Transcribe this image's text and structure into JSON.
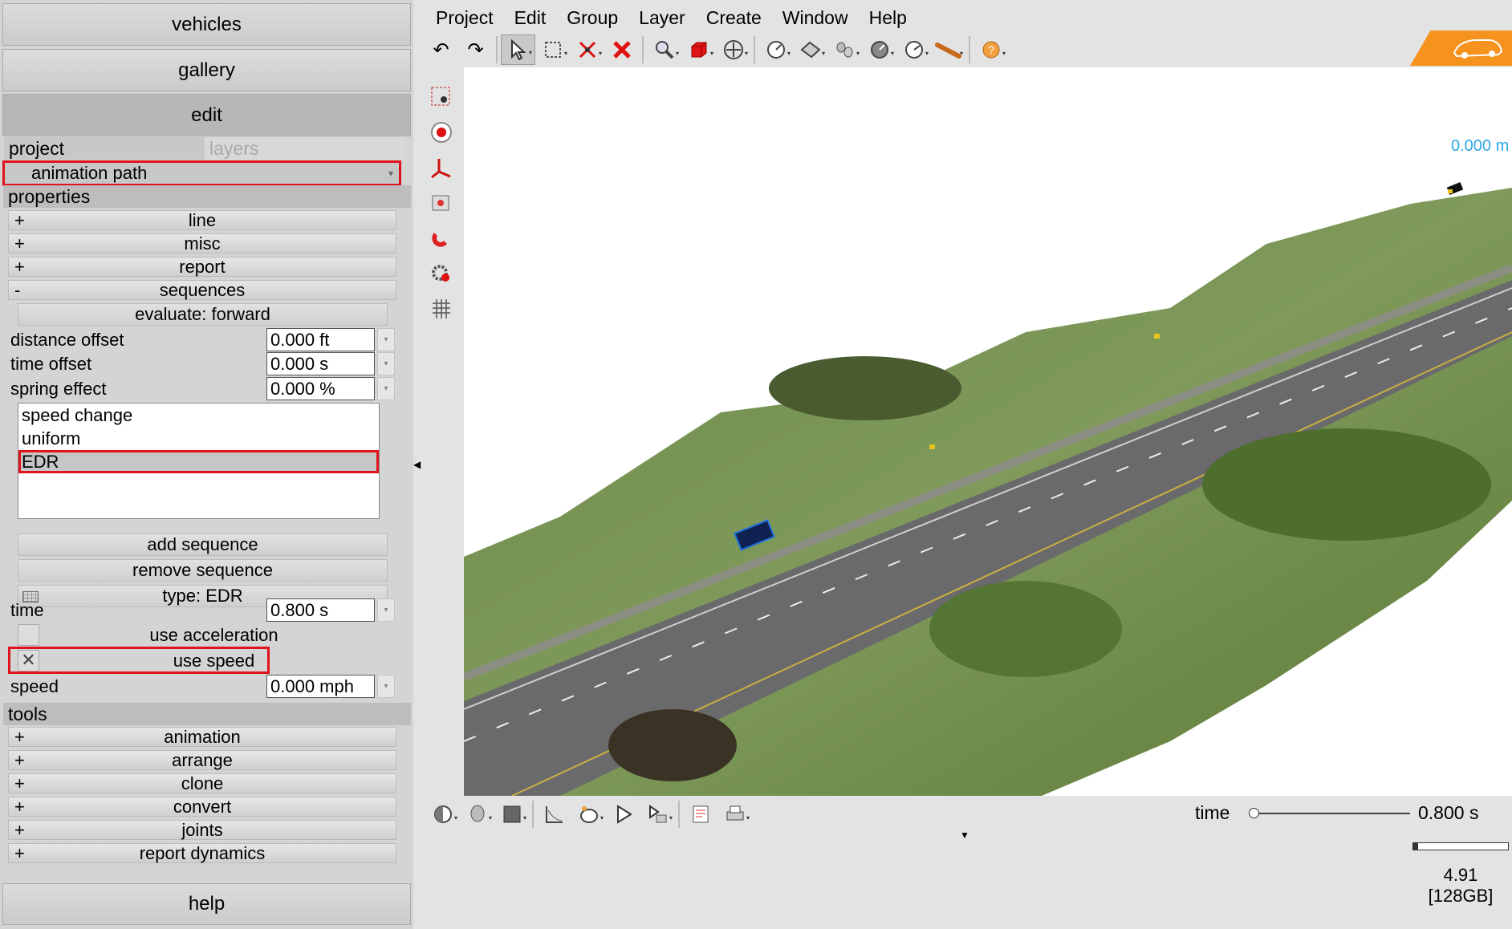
{
  "nav": {
    "vehicles": "vehicles",
    "gallery": "gallery",
    "edit": "edit",
    "help": "help"
  },
  "tabs": {
    "project": "project",
    "layers": "layers"
  },
  "selected_object": "animation path",
  "properties": {
    "header": "properties",
    "groups": [
      {
        "sign": "+",
        "label": "line"
      },
      {
        "sign": "+",
        "label": "misc"
      },
      {
        "sign": "+",
        "label": "report"
      },
      {
        "sign": "-",
        "label": "sequences"
      }
    ],
    "evaluate": "evaluate: forward",
    "distance_offset": {
      "label": "distance offset",
      "value": "0.000 ft"
    },
    "time_offset": {
      "label": "time offset",
      "value": "0.000 s"
    },
    "spring_effect": {
      "label": "spring effect",
      "value": "0.000 %"
    },
    "sequence_list": [
      "speed change",
      "uniform",
      "EDR"
    ],
    "selected_sequence": "EDR",
    "add_sequence": "add sequence",
    "remove_sequence": "remove sequence",
    "type": "type: EDR",
    "time": {
      "label": "time",
      "value": "0.800 s"
    },
    "use_acceleration": {
      "label": "use acceleration",
      "checked": false
    },
    "use_speed": {
      "label": "use speed",
      "checked": true
    },
    "speed": {
      "label": "speed",
      "value": "0.000 mph"
    }
  },
  "tools": {
    "header": "tools",
    "groups": [
      {
        "sign": "+",
        "label": "animation"
      },
      {
        "sign": "+",
        "label": "arrange"
      },
      {
        "sign": "+",
        "label": "clone"
      },
      {
        "sign": "+",
        "label": "convert"
      },
      {
        "sign": "+",
        "label": "joints"
      },
      {
        "sign": "+",
        "label": "report dynamics"
      }
    ]
  },
  "menu": [
    "Project",
    "Edit",
    "Group",
    "Layer",
    "Create",
    "Window",
    "Help"
  ],
  "colors": {
    "highlight": "#e0121d",
    "accent": "#f6931e",
    "measure": "#2ea8e6"
  },
  "toolbar_icons": [
    "undo-icon",
    "redo-icon",
    "select-arrow-icon",
    "rectangle-select-icon",
    "erase-points-icon",
    "delete-icon",
    "zoom-icon",
    "box-3d-icon",
    "move-icon",
    "measure-gauge-icon",
    "surface-icon",
    "tire-icon",
    "dial-icon",
    "speedometer-icon",
    "tape-icon",
    "help-icon"
  ],
  "viewport": {
    "measurement": "0.000 m"
  },
  "timeline": {
    "label": "time",
    "value": "0.800 s",
    "position": 0,
    "progress": 0.05
  },
  "status": {
    "value": "4.91",
    "memory": "[128GB]"
  }
}
